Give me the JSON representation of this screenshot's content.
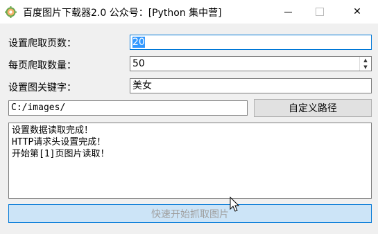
{
  "window": {
    "title": "百度图片下载器2.0  公众号：[Python 集中营]",
    "minimize_label": "—",
    "close_label": "✕"
  },
  "form": {
    "pages_label": "设置爬取页数：",
    "pages_value": "20",
    "count_label": "每页爬取数量：",
    "count_value": "50",
    "keyword_label": "设置图关键字：",
    "keyword_value": "美女",
    "path_value": "C:/images/",
    "custom_path_button": "自定义路径"
  },
  "log": {
    "lines": [
      "设置数据读取完成！",
      "HTTP请求头设置完成！",
      "开始第[1]页图片读取！"
    ]
  },
  "actions": {
    "start_button": "快速开始抓取图片"
  }
}
